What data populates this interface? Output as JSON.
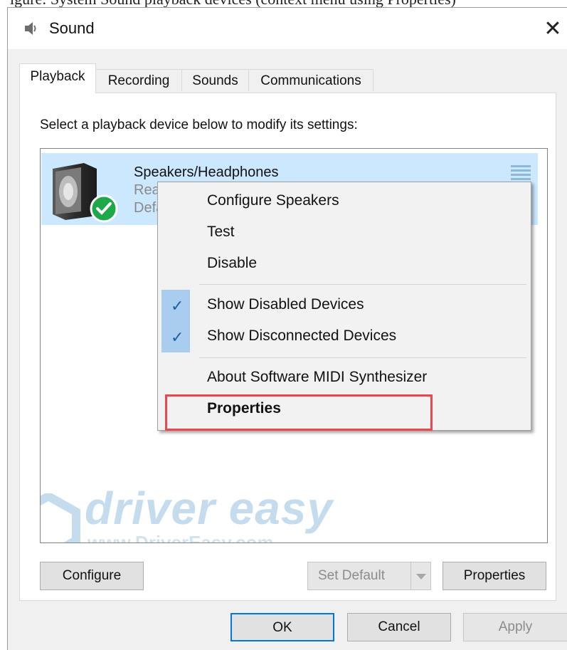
{
  "caption_text": "igure: System Sound playback devices (context menu using Properties)",
  "window": {
    "title": "Sound",
    "close_symbol": "✕",
    "icon": "speaker-icon"
  },
  "tabs": [
    {
      "label": "Playback",
      "active": true
    },
    {
      "label": "Recording",
      "active": false
    },
    {
      "label": "Sounds",
      "active": false
    },
    {
      "label": "Communications",
      "active": false
    }
  ],
  "instruction": "Select a playback device below to modify its settings:",
  "device": {
    "name": "Speakers/Headphones",
    "driver": "Realtek(R) Audio",
    "status": "Default Device",
    "status_icon": "green-check-icon"
  },
  "context_menu": {
    "items": [
      {
        "label": "Configure Speakers",
        "checked": false,
        "bold": false
      },
      {
        "label": "Test",
        "checked": false,
        "bold": false
      },
      {
        "label": "Disable",
        "checked": false,
        "bold": false
      },
      {
        "label": "Show Disabled Devices",
        "checked": true,
        "bold": false
      },
      {
        "label": "Show Disconnected Devices",
        "checked": true,
        "bold": false
      },
      {
        "label": "About Software MIDI Synthesizer",
        "checked": false,
        "bold": false
      },
      {
        "label": "Properties",
        "checked": false,
        "bold": true
      }
    ],
    "check_symbol": "✓"
  },
  "buttons": {
    "configure": "Configure",
    "set_default": "Set Default",
    "properties": "Properties",
    "ok": "OK",
    "cancel": "Cancel",
    "apply": "Apply"
  },
  "watermark": {
    "brand": "driver easy",
    "url": "www.DriverEasy.com"
  },
  "colors": {
    "selection": "#cce8ff",
    "check_bg": "#a9cdef",
    "highlight": "#e8474e",
    "ok_border": "#0078d7",
    "status_green": "#1ea84a"
  }
}
